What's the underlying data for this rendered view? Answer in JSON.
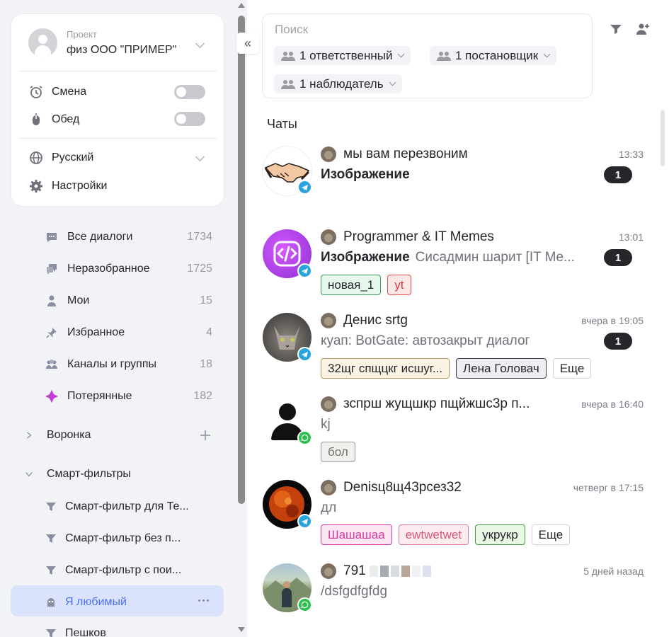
{
  "project": {
    "caption": "Проект",
    "name": "физ ООО \"ПРИМЕР\""
  },
  "settings": {
    "shift_label": "Смена",
    "lunch_label": "Обед",
    "language_label": "Русский",
    "settings_label": "Настройки"
  },
  "nav": {
    "items": [
      {
        "label": "Все диалоги",
        "count": "1734"
      },
      {
        "label": "Неразобранное",
        "count": "1725"
      },
      {
        "label": "Мои",
        "count": "15"
      },
      {
        "label": "Избранное",
        "count": "4"
      },
      {
        "label": "Каналы и группы",
        "count": "18"
      },
      {
        "label": "Потерянные",
        "count": "182"
      }
    ],
    "funnel_label": "Воронка",
    "smart_filters_label": "Смарт-фильтры",
    "smart_filters": [
      "Смарт-фильтр для Те...",
      "Смарт-фильтр без п...",
      "Смарт-фильтр с пои...",
      "Я любимый",
      "Пешков"
    ]
  },
  "search": {
    "placeholder": "Поиск",
    "chips": [
      "1 ответственный",
      "1 постановщик",
      "1 наблюдатель"
    ]
  },
  "colors": {
    "accent": "#dae3fb",
    "active_text": "#4c6ef5",
    "telegram": "#2aa3dc",
    "whatsapp": "#29c14a",
    "lost_icon": "#c03fd6"
  },
  "chats_title": "Чаты",
  "chats": [
    {
      "name": "мы вам перезвоним",
      "time": "13:33",
      "msg_bold": "Изображение",
      "msg_sub": "",
      "unread": "1",
      "channel": "telegram",
      "avatar": "handshake-icon",
      "tags": []
    },
    {
      "name": "Programmer & IT Memes",
      "time": "13:01",
      "msg_bold": "Изображение",
      "msg_sub": "Сисадмин шарит [IT Me...",
      "unread": "1",
      "channel": "telegram",
      "avatar": "code-icon",
      "tags": [
        {
          "label": "новая_1",
          "bg": "#e6f7ec",
          "border": "#3c9a5b",
          "color": "#26262b"
        },
        {
          "label": "yt",
          "bg": "#fde8e8",
          "border": "#e05252",
          "color": "#d43a3a"
        }
      ]
    },
    {
      "name": "Денис srtg",
      "time": "вчера в 19:05",
      "msg_bold": "",
      "msg_sub": "куап: BotGate: автозакрыт диалог",
      "unread": "1",
      "channel": "telegram",
      "avatar": "cat-photo",
      "tags": [
        {
          "label": "32щг спщцкг исшуг...",
          "bg": "#faf3e3",
          "border": "#b89a5c",
          "color": "#26262b"
        },
        {
          "label": "Лена Головач",
          "bg": "#eceef2",
          "border": "#3c3f48",
          "color": "#26262b"
        },
        {
          "label": "Еще",
          "bg": "#ffffff",
          "border": "#d3d4d8",
          "color": "#26262b"
        }
      ]
    },
    {
      "name": "зспрш жущшкр пщйжшс3р п...",
      "time": "вчера в 16:40",
      "msg_bold": "",
      "msg_sub": "kj",
      "unread": "",
      "channel": "whatsapp",
      "avatar": "person-icon",
      "tags": [
        {
          "label": "бол",
          "bg": "#f1f1ef",
          "border": "#9b9b94",
          "color": "#6f6f68"
        }
      ]
    },
    {
      "name": "Denisц8щ43рсез32",
      "time": "четверг в 17:15",
      "msg_bold": "",
      "msg_sub": "дл",
      "unread": "",
      "channel": "telegram",
      "avatar": "planet-photo",
      "tags": [
        {
          "label": "Шашашаа",
          "bg": "#fde6f3",
          "border": "#d63aa0",
          "color": "#d63aa0"
        },
        {
          "label": "ewtwetwet",
          "bg": "#fdecef",
          "border": "#e07b93",
          "color": "#d45a77"
        },
        {
          "label": "укрукр",
          "bg": "#e9f7e4",
          "border": "#3e9a3b",
          "color": "#26262b"
        },
        {
          "label": "Еще",
          "bg": "#ffffff",
          "border": "#d3d4d8",
          "color": "#26262b"
        }
      ]
    },
    {
      "name": "791",
      "time": "5 дней назад",
      "msg_bold": "",
      "msg_sub": "/dsfgdfgfdg",
      "unread": "",
      "channel": "whatsapp",
      "avatar": "mountain-photo",
      "tags": []
    }
  ]
}
